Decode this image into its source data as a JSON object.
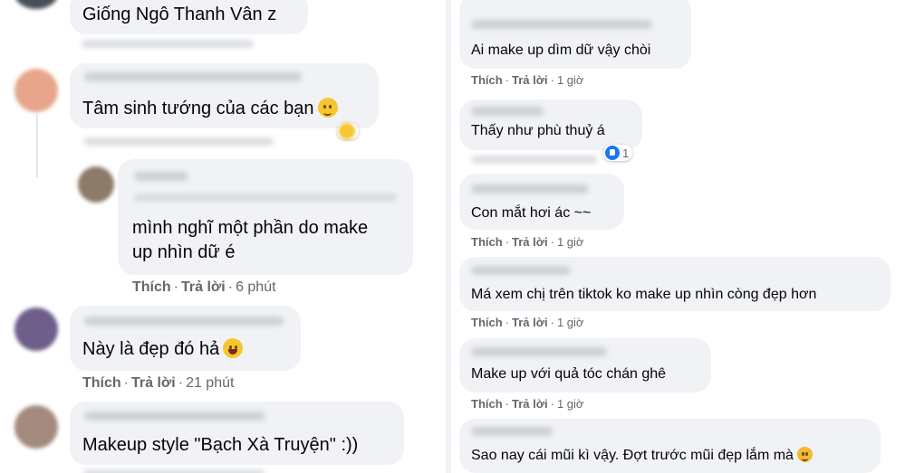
{
  "left": {
    "comments": [
      {
        "text": "Giống Ngô Thanh Vân z",
        "actions": null
      },
      {
        "text": "Tâm sinh tướng của các bạn",
        "emoji": "slight-smile",
        "actions": null
      },
      {
        "text_line1": "mình nghĩ một phần do make",
        "text_line2": "up nhìn dữ é",
        "like": "Thích",
        "reply": "Trả lời",
        "time": "6 phút"
      },
      {
        "text": "Này là đẹp đó hả",
        "emoji": "laugh",
        "like": "Thích",
        "reply": "Trả lời",
        "time": "21 phút"
      },
      {
        "text": "Makeup style \"Bạch Xà Truyện\" :))",
        "actions": null
      }
    ]
  },
  "right": {
    "comments": [
      {
        "text": "Ai make up dìm dữ vậy chòi",
        "like": "Thích",
        "reply": "Trả lời",
        "time": "1 giờ"
      },
      {
        "text": "Thấy như phù thuỷ á",
        "reaction_count": "1"
      },
      {
        "text": "Con mắt hơi ác ~~",
        "like": "Thích",
        "reply": "Trả lời",
        "time": "1 giờ"
      },
      {
        "text": "Má xem chị trên tiktok ko make up nhìn còng đẹp hơn",
        "like": "Thích",
        "reply": "Trả lời",
        "time": "1 giờ"
      },
      {
        "text": "Make up với quả tóc chán ghê",
        "like": "Thích",
        "reply": "Trả lời",
        "time": "1 giờ"
      },
      {
        "text": "Sao nay cái mũi kì vậy. Đợt trước mũi đẹp lắm mà",
        "emoji": "pleading"
      }
    ]
  },
  "colors": {
    "bubble": "#f0f2f5",
    "meta": "#65676b",
    "text": "#050505",
    "like_blue": "#1877f2"
  }
}
